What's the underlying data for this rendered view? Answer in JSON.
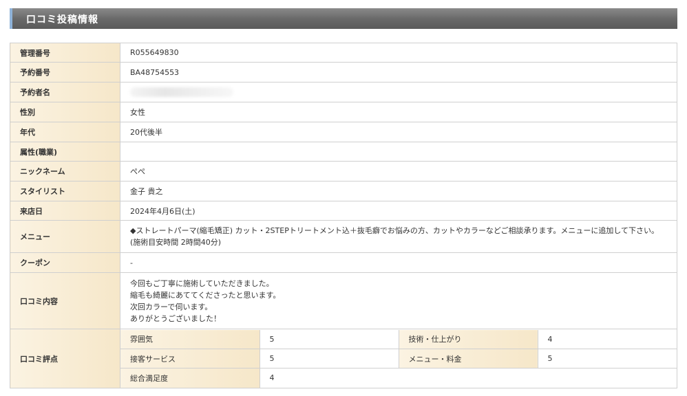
{
  "header": {
    "title": "口コミ投稿情報"
  },
  "rows": {
    "management_no": {
      "label": "管理番号",
      "value": "R055649830"
    },
    "reservation_no": {
      "label": "予約番号",
      "value": "BA48754553"
    },
    "reserver_name": {
      "label": "予約者名",
      "value": ""
    },
    "gender": {
      "label": "性別",
      "value": "女性"
    },
    "age": {
      "label": "年代",
      "value": "20代後半"
    },
    "occupation": {
      "label": "属性(職業)",
      "value": ""
    },
    "nickname": {
      "label": "ニックネーム",
      "value": "ぺぺ"
    },
    "stylist": {
      "label": "スタイリスト",
      "value": "金子 貴之"
    },
    "visit_date": {
      "label": "来店日",
      "value": "2024年4月6日(土)"
    },
    "menu": {
      "label": "メニュー",
      "line1": "◆ストレートパーマ(縮毛矯正) カット・2STEPトリートメント込＋抜毛癖でお悩みの方、カットやカラーなどご相談承ります。メニューに追加して下さい。",
      "line2": "(施術目安時間 2時間40分)"
    },
    "coupon": {
      "label": "クーポン",
      "value": "-"
    },
    "review": {
      "label": "口コミ内容",
      "lines": [
        "今回もご丁寧に施術していただきました。",
        "縮毛も綺麗にあててくださったと思います。",
        "次回カラーで伺います。",
        "ありがとうございました！"
      ]
    },
    "rating": {
      "label": "口コミ評点",
      "atmosphere_label": "雰囲気",
      "atmosphere_value": "5",
      "technique_label": "技術・仕上がり",
      "technique_value": "4",
      "service_label": "接客サービス",
      "service_value": "5",
      "menu_price_label": "メニュー・料金",
      "menu_price_value": "5",
      "overall_label": "総合満足度",
      "overall_value": "4"
    }
  }
}
